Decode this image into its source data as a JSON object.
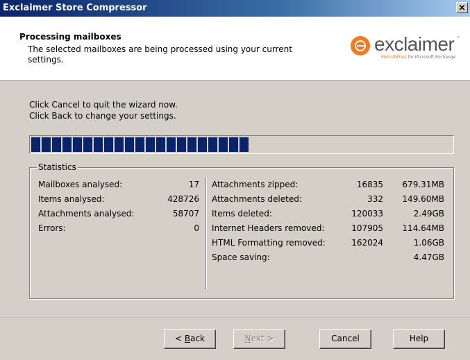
{
  "window": {
    "title": "Exclaimer Store Compressor",
    "close_label": "×"
  },
  "header": {
    "heading": "Processing mailboxes",
    "subtext": "The selected mailboxes are being processed using your current settings.",
    "logo_word": "exclaimer",
    "logo_tm": "™",
    "logo_tag_accent": "Mail Utilities",
    "logo_tag_rest": "for Microsoft Exchange"
  },
  "instructions": {
    "line1": "Click Cancel to quit the wizard now.",
    "line2": "Click Back to change your settings."
  },
  "progress": {
    "filled_blocks": 21,
    "fraction": 0.52
  },
  "statistics": {
    "legend": "Statistics",
    "left": [
      {
        "label": "Mailboxes analysed:",
        "value": "17"
      },
      {
        "label": "Items analysed:",
        "value": "428726"
      },
      {
        "label": "Attachments analysed:",
        "value": "58707"
      },
      {
        "label": "Errors:",
        "value": "0"
      }
    ],
    "right": [
      {
        "label": "Attachments zipped:",
        "count": "16835",
        "size": "679.31MB"
      },
      {
        "label": "Attachments deleted:",
        "count": "332",
        "size": "149.60MB"
      },
      {
        "label": "Items deleted:",
        "count": "120033",
        "size": "2.49GB"
      },
      {
        "label": "Internet Headers removed:",
        "count": "107905",
        "size": "114.64MB"
      },
      {
        "label": "HTML Formatting removed:",
        "count": "162024",
        "size": "1.06GB"
      },
      {
        "label": "Space saving:",
        "count": "",
        "size": "4.47GB"
      }
    ]
  },
  "buttons": {
    "back_pre": "< ",
    "back_key": "B",
    "back_post": "ack",
    "next_key": "N",
    "next_post": "ext >",
    "cancel": "Cancel",
    "help": "Help"
  }
}
